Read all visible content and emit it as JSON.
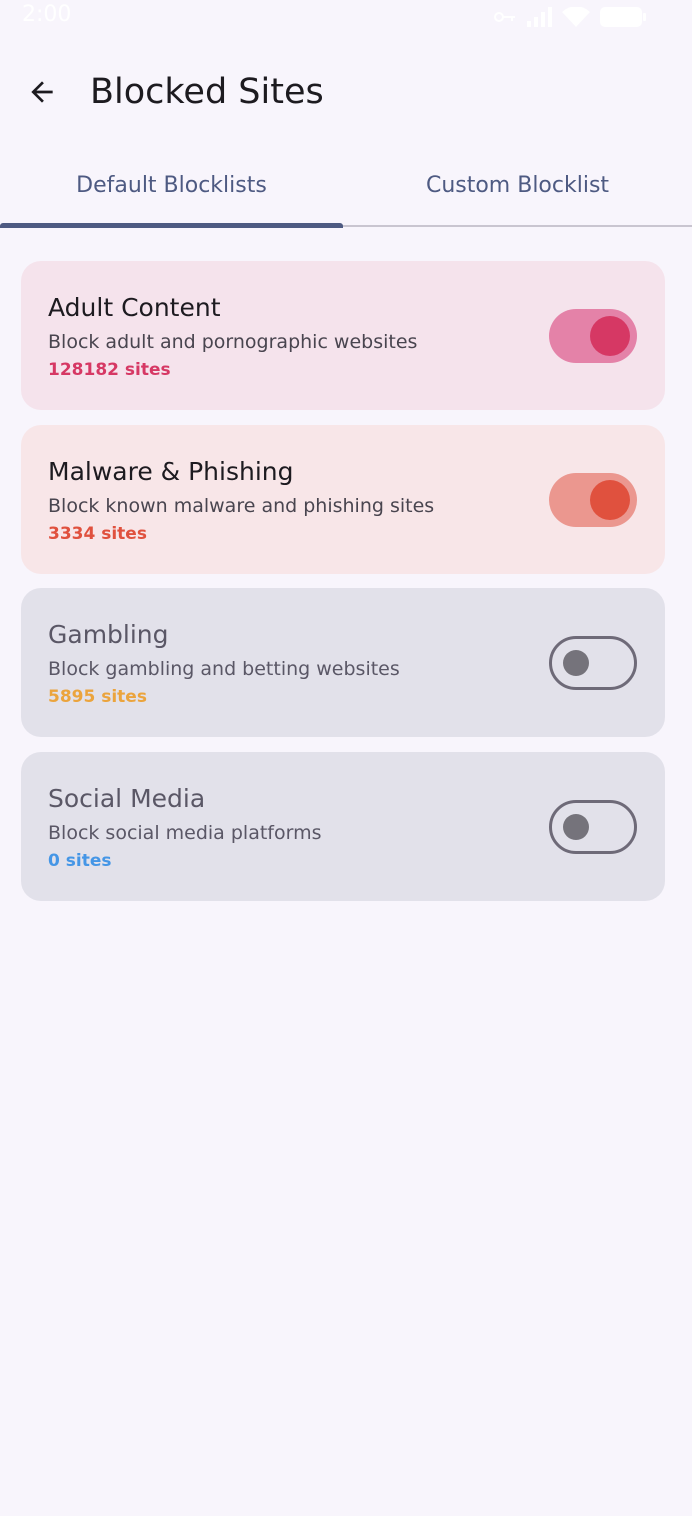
{
  "status_bar": {
    "time": "2:00"
  },
  "header": {
    "back_icon": "arrow-back-icon",
    "title": "Blocked Sites"
  },
  "tabs": [
    {
      "label": "Default Blocklists",
      "selected": true
    },
    {
      "label": "Custom Blocklist",
      "selected": false
    }
  ],
  "blocklists": [
    {
      "title": "Adult Content",
      "description": "Block adult and pornographic websites",
      "count": "128182 sites",
      "enabled": true,
      "accent": "#d63864",
      "card_bg": "#f5e3ec",
      "track": "#e482a8"
    },
    {
      "title": "Malware & Phishing",
      "description": "Block known malware and phishing sites",
      "count": "3334 sites",
      "enabled": true,
      "accent": "#e0513e",
      "card_bg": "#f8e6e8",
      "track": "#eb978f"
    },
    {
      "title": "Gambling",
      "description": "Block gambling and betting websites",
      "count": "5895 sites",
      "enabled": false,
      "accent": "#eba43d",
      "card_bg": "#e2e1ea"
    },
    {
      "title": "Social Media",
      "description": "Block social media platforms",
      "count": "0 sites",
      "enabled": false,
      "accent": "#4596e6",
      "card_bg": "#e2e1ea"
    }
  ]
}
